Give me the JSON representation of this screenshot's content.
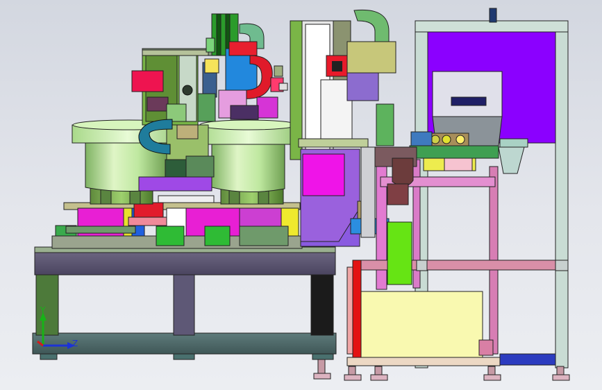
{
  "viewport": {
    "background_top": "#d3d7e0",
    "background_bottom": "#eceef2"
  },
  "triad": {
    "y_label": "Y",
    "z_label": "Z",
    "y_color": "#17b317",
    "z_color": "#1c33d6",
    "x_color": "#d21c1c"
  },
  "palette": {
    "bowl_green": "#b9e49b",
    "frame_gray": "#586a69",
    "frame_dark": "#585167",
    "purple": "#8b00ff",
    "magenta": "#e000e0",
    "yellow": "#f9f9b0",
    "cyan_blue": "#2a8ddf",
    "red": "#e11b2c",
    "pink": "#f18ab1",
    "lime": "#77ee0e"
  }
}
